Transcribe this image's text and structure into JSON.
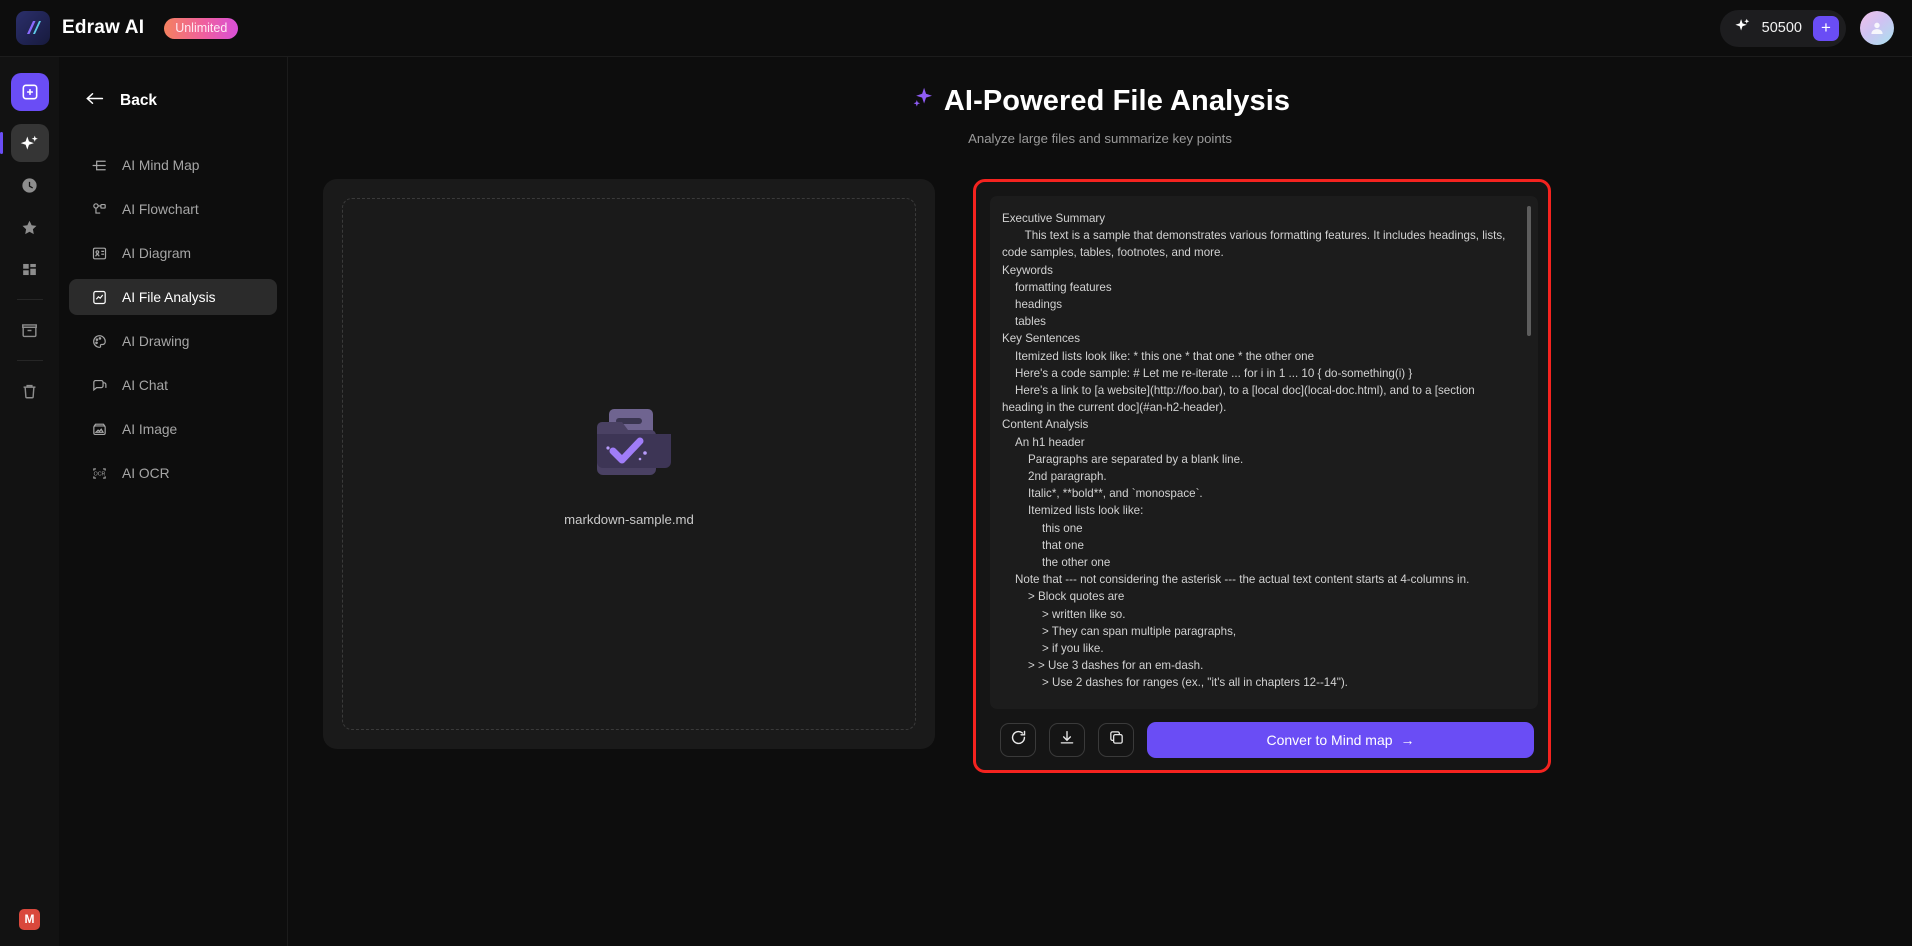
{
  "topbar": {
    "logo_icon": "edraw-logo-icon",
    "brand": "Edraw AI",
    "plan": "Unlimited",
    "credits_icon": "sparkle-icon",
    "credits": "50500",
    "credits_add": "+",
    "avatar_icon": "user-avatar-icon",
    "accent": "#6a4df5"
  },
  "rail": {
    "items": [
      {
        "name": "new-document-button",
        "icon": "plus-square-icon"
      },
      {
        "name": "ai-tools-button",
        "icon": "sparkle-icon"
      },
      {
        "name": "recent-button",
        "icon": "clock-icon"
      },
      {
        "name": "favorites-button",
        "icon": "star-icon"
      },
      {
        "name": "templates-button",
        "icon": "templates-icon"
      },
      {
        "name": "archive-button",
        "icon": "folder-icon"
      },
      {
        "name": "trash-button",
        "icon": "trash-icon"
      }
    ],
    "badge": "M"
  },
  "sidebar": {
    "back_label": "Back",
    "back_icon": "arrow-left-icon",
    "items": [
      {
        "label": "AI Mind Map",
        "icon": "mind-map-icon"
      },
      {
        "label": "AI Flowchart",
        "icon": "flowchart-icon"
      },
      {
        "label": "AI Diagram",
        "icon": "diagram-icon"
      },
      {
        "label": "AI File Analysis",
        "icon": "file-analysis-icon"
      },
      {
        "label": "AI Drawing",
        "icon": "palette-icon"
      },
      {
        "label": "AI Chat",
        "icon": "chat-bubble-icon"
      },
      {
        "label": "AI Image",
        "icon": "image-icon"
      },
      {
        "label": "AI OCR",
        "icon": "ocr-icon"
      }
    ],
    "selected_index": 3
  },
  "page": {
    "title_icon": "sparkle-icon",
    "title": "AI-Powered File Analysis",
    "subtitle": "Analyze large files and summarize key points"
  },
  "upload": {
    "file_icon": "folder-check-icon",
    "file_name": "markdown-sample.md"
  },
  "analysis": {
    "highlight_color": "#f4231f",
    "lines": [
      {
        "indent": 0,
        "text": "Executive Summary"
      },
      {
        "indent": 0,
        "wrap": true,
        "text": "   This text is a sample that demonstrates various formatting features. It includes headings, lists, code samples, tables, footnotes, and more."
      },
      {
        "indent": 0,
        "text": "Keywords"
      },
      {
        "indent": 1,
        "text": "formatting features"
      },
      {
        "indent": 1,
        "text": "headings"
      },
      {
        "indent": 1,
        "text": "tables"
      },
      {
        "indent": 0,
        "text": "Key Sentences"
      },
      {
        "indent": 1,
        "text": "Itemized lists look like: * this one * that one * the other one"
      },
      {
        "indent": 1,
        "text": "Here's a code sample: # Let me re-iterate ... for i in 1 ... 10 { do-something(i) }"
      },
      {
        "indent": 1,
        "wrap": true,
        "text": "Here's a link to [a website](http://foo.bar), to a [local doc](local-doc.html), and to a [section heading in the current doc](#an-h2-header)."
      },
      {
        "indent": 0,
        "text": "Content Analysis"
      },
      {
        "indent": 1,
        "text": "An h1 header"
      },
      {
        "indent": 2,
        "text": "Paragraphs are separated by a blank line."
      },
      {
        "indent": 2,
        "text": "2nd paragraph."
      },
      {
        "indent": 2,
        "text": "Italic*, **bold**, and `monospace`."
      },
      {
        "indent": 2,
        "text": "Itemized lists look like:"
      },
      {
        "indent": 3,
        "text": "this one"
      },
      {
        "indent": 3,
        "text": "that one"
      },
      {
        "indent": 3,
        "text": "the other one"
      },
      {
        "indent": 1,
        "text": "Note that --- not considering the asterisk --- the actual text content starts at 4-columns in."
      },
      {
        "indent": 2,
        "text": "> Block quotes are"
      },
      {
        "indent": 3,
        "text": "> written like so."
      },
      {
        "indent": 3,
        "text": "> They can span multiple paragraphs,"
      },
      {
        "indent": 3,
        "text": "> if you like."
      },
      {
        "indent": 2,
        "text": "> > Use 3 dashes for an em-dash."
      },
      {
        "indent": 3,
        "text": "> Use 2 dashes for ranges (ex., \"it's all in chapters 12--14\")."
      }
    ],
    "toolbar": [
      {
        "name": "regenerate-button",
        "icon": "refresh-icon"
      },
      {
        "name": "download-button",
        "icon": "download-icon"
      },
      {
        "name": "copy-button",
        "icon": "copy-icon"
      }
    ],
    "cta_label": "Conver to Mind map",
    "cta_arrow": "→"
  }
}
